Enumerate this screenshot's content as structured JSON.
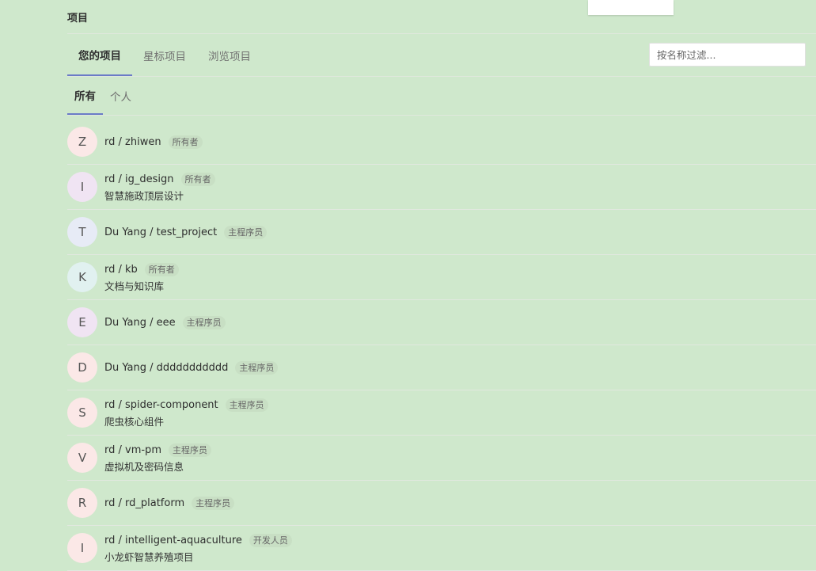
{
  "page_title": "项目",
  "tabs": [
    {
      "label": "您的项目"
    },
    {
      "label": "星标项目"
    },
    {
      "label": "浏览项目"
    }
  ],
  "filter": {
    "placeholder": "按名称过滤..."
  },
  "subtabs": [
    {
      "label": "所有"
    },
    {
      "label": "个人"
    }
  ],
  "projects": [
    {
      "letter": "Z",
      "name": "rd / zhiwen",
      "role": "所有者",
      "desc": "",
      "color": "#fbe8e7"
    },
    {
      "letter": "I",
      "name": "rd / ig_design",
      "role": "所有者",
      "desc": "智慧施政顶层设计",
      "color": "#f0e4f3"
    },
    {
      "letter": "T",
      "name": "Du Yang / test_project",
      "role": "主程序员",
      "desc": "",
      "color": "#e7ebf6"
    },
    {
      "letter": "K",
      "name": "rd / kb",
      "role": "所有者",
      "desc": "文档与知识库",
      "color": "#e1f1f0"
    },
    {
      "letter": "E",
      "name": "Du Yang / eee",
      "role": "主程序员",
      "desc": "",
      "color": "#f0e4f3"
    },
    {
      "letter": "D",
      "name": "Du Yang / ddddddddddd",
      "role": "主程序员",
      "desc": "",
      "color": "#fbe8e7"
    },
    {
      "letter": "S",
      "name": "rd / spider-component",
      "role": "主程序员",
      "desc": "爬虫核心组件",
      "color": "#fbe8e7"
    },
    {
      "letter": "V",
      "name": "rd / vm-pm",
      "role": "主程序员",
      "desc": "虚拟机及密码信息",
      "color": "#fbe8e7"
    },
    {
      "letter": "R",
      "name": "rd / rd_platform",
      "role": "主程序员",
      "desc": "",
      "color": "#fbe8e7"
    },
    {
      "letter": "I",
      "name": "rd / intelligent-aquaculture",
      "role": "开发人员",
      "desc": "小龙虾智慧养殖项目",
      "color": "#fbe8e7"
    }
  ]
}
